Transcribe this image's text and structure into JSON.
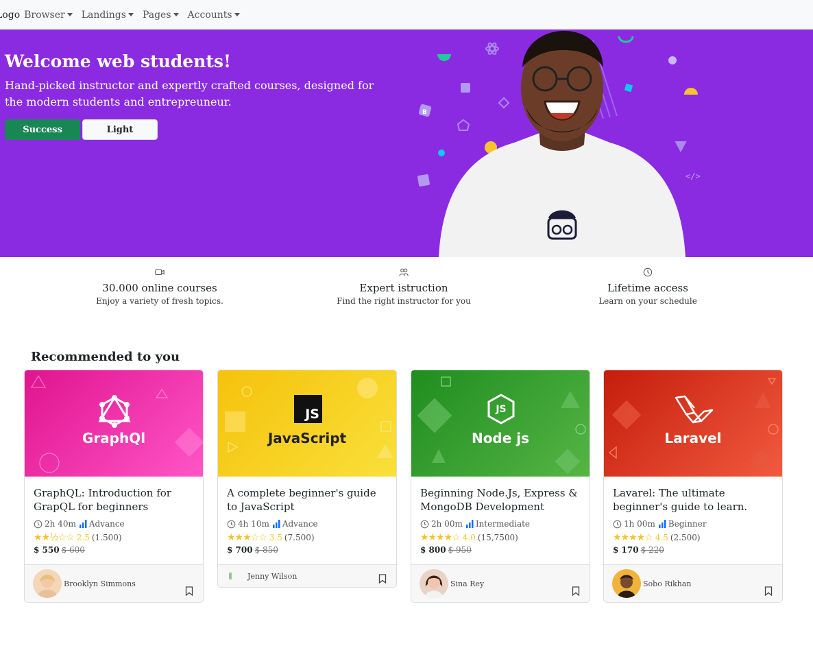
{
  "nav": {
    "brand": "Logo",
    "items": [
      "Browser",
      "Landings",
      "Pages",
      "Accounts"
    ]
  },
  "hero": {
    "title": "Welcome web students!",
    "subtitle": "Hand-picked instructor and expertly crafted courses, designed for the modern students and entrepreuneur.",
    "primary_button": "Success",
    "secondary_button": "Light",
    "background_color": "#8a2be2"
  },
  "features": [
    {
      "icon": "video-icon",
      "title": "30.000 online courses",
      "subtitle": "Enjoy a variety of fresh topics."
    },
    {
      "icon": "people-icon",
      "title": "Expert istruction",
      "subtitle": "Find the right instructor for you"
    },
    {
      "icon": "clock-icon",
      "title": "Lifetime access",
      "subtitle": "Learn on your schedule"
    }
  ],
  "recommended": {
    "title": "Recommended to you",
    "cards": [
      {
        "image_label": "GraphQl",
        "title": "GraphQL: Introduction for GrapQL for beginners",
        "duration": "2h 40m",
        "level": "Advance",
        "stars": "★★½☆☆",
        "rating": "2.5",
        "rating_count": "(1.500)",
        "price": "$ 550",
        "old_price": "$ 600",
        "author": "Brooklyn Simmons",
        "color_a": "#e0148f",
        "color_b": "#ff55c7"
      },
      {
        "image_label": "JavaScript",
        "logo_text": "JS",
        "title": "A complete beginner's guide to JavaScript",
        "duration": "4h 10m",
        "level": "Advance",
        "stars": "★★★☆☆",
        "rating": "3.5",
        "rating_count": "(7.500)",
        "price": "$ 700",
        "old_price": "$ 850",
        "author": "Jenny Wilson",
        "color_a": "#f5c20c",
        "color_b": "#f9e03a"
      },
      {
        "image_label": "Node js",
        "logo_text": "JS",
        "title": "Beginning Node.Js, Express & MongoDB Development",
        "duration": "2h 00m",
        "level": "Intermediate",
        "stars": "★★★★☆",
        "rating": "4.0",
        "rating_count": "(15,7500)",
        "price": "$ 800",
        "old_price": "$ 950",
        "author": "Sina Rey",
        "color_a": "#1f8d1f",
        "color_b": "#55b545"
      },
      {
        "image_label": "Laravel",
        "title": "Lavarel: The ultimate beginner's guide to learn.",
        "duration": "1h 00m",
        "level": "Beginner",
        "stars": "★★★★☆",
        "rating": "4.5",
        "rating_count": "(2.500)",
        "price": "$ 170",
        "old_price": "$ 220",
        "author": "Sobo Rikhan",
        "color_a": "#c41d0c",
        "color_b": "#f25a3e"
      }
    ]
  }
}
